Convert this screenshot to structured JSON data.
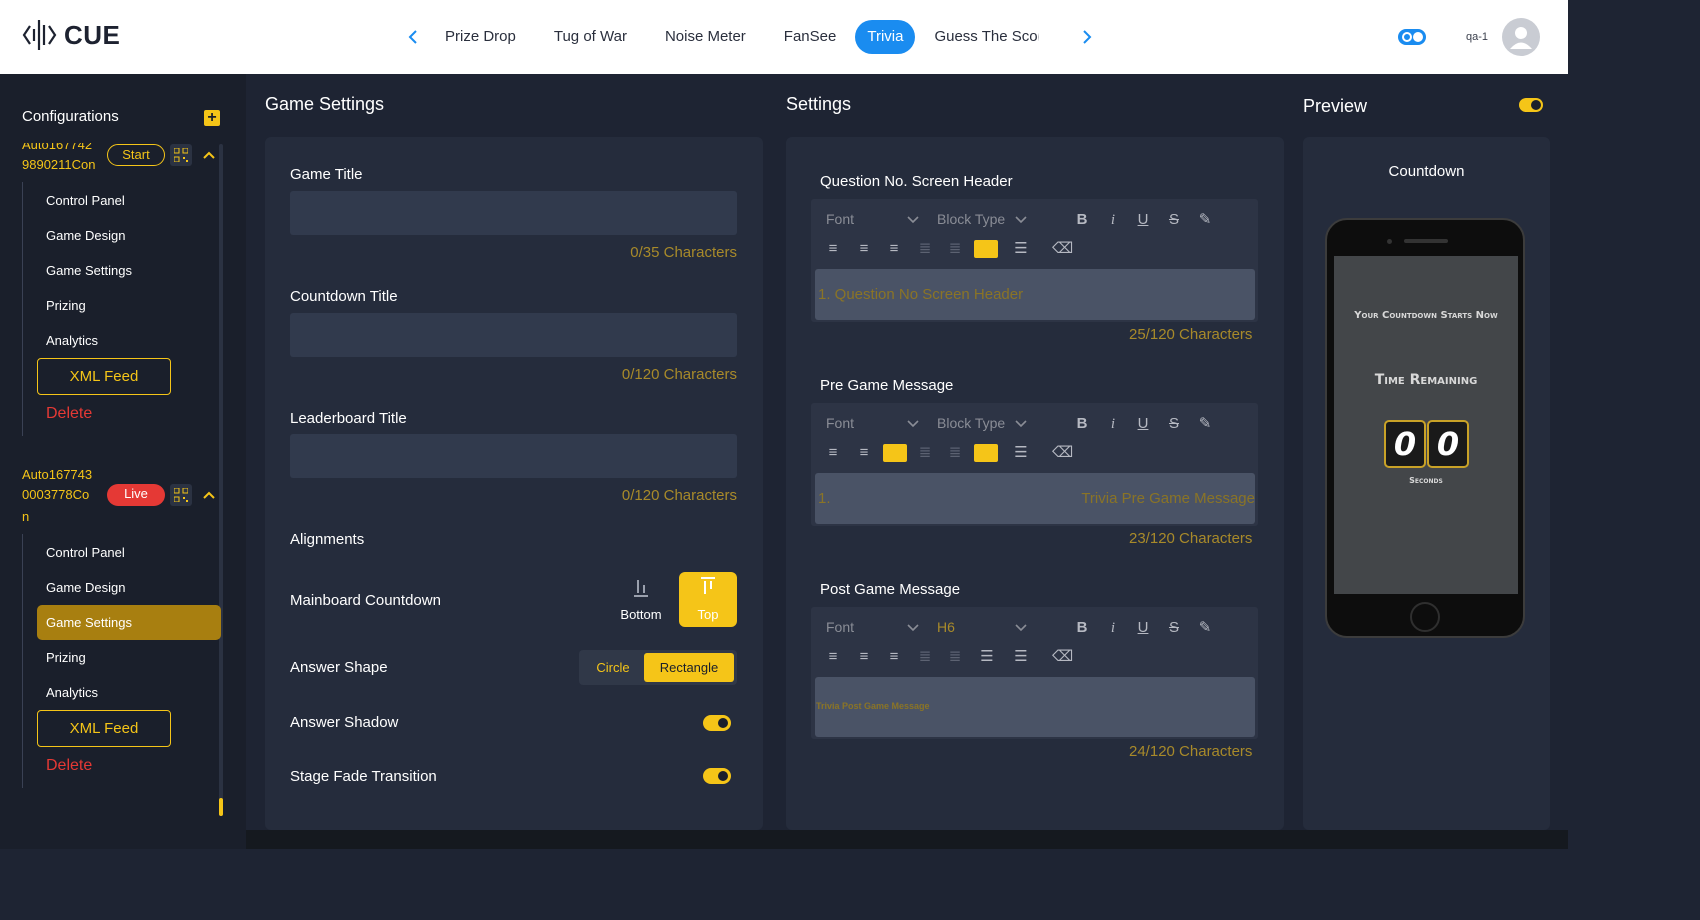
{
  "brand": {
    "name": "CUE"
  },
  "nav": {
    "tabs": [
      "Prize Drop",
      "Tug of War",
      "Noise Meter",
      "FanSee",
      "Trivia",
      "Guess The Score"
    ],
    "active_index": 4
  },
  "user": {
    "name": "qa-1"
  },
  "sidebar": {
    "heading": "Configurations",
    "configs": [
      {
        "name_line1": "Auto167742",
        "name_line2": "9890211Con",
        "status": "Start",
        "items": [
          "Control Panel",
          "Game Design",
          "Game Settings",
          "Prizing",
          "Analytics"
        ],
        "xml": "XML Feed",
        "delete": "Delete"
      },
      {
        "name_line1": "Auto167743",
        "name_line2": "0003778Co",
        "name_line3": "n",
        "status": "Live",
        "items": [
          "Control Panel",
          "Game Design",
          "Game Settings",
          "Prizing",
          "Analytics"
        ],
        "active_item": "Game Settings",
        "xml": "XML Feed",
        "delete": "Delete"
      }
    ]
  },
  "game_settings": {
    "heading": "Game Settings",
    "fields": [
      {
        "label": "Game Title",
        "value": "",
        "count": "0/35 Characters"
      },
      {
        "label": "Countdown Title",
        "value": "",
        "count": "0/120 Characters"
      },
      {
        "label": "Leaderboard Title",
        "value": "",
        "count": "0/120 Characters"
      }
    ],
    "alignments_label": "Alignments",
    "mainboard_label": "Mainboard Countdown",
    "bottom_label": "Bottom",
    "top_label": "Top",
    "answer_shape_label": "Answer Shape",
    "shape_circle": "Circle",
    "shape_rect": "Rectangle",
    "answer_shadow_label": "Answer Shadow",
    "answer_shadow_on": true,
    "stage_fade_label": "Stage Fade Transition",
    "stage_fade_on": true
  },
  "settings": {
    "heading": "Settings",
    "font_placeholder": "Font",
    "block_placeholder": "Block Type",
    "sections": [
      {
        "label": "Question No. Screen Header",
        "block": "Block Type",
        "content": "1.  Question No Screen Header",
        "count": "25/120 Characters"
      },
      {
        "label": "Pre Game Message",
        "block": "Block Type",
        "content_prefix": "1.",
        "content": "Trivia Pre Game Message",
        "count": "23/120 Characters"
      },
      {
        "label": "Post Game Message",
        "block": "H6",
        "content": "Trivia Post Game Message",
        "count": "24/120 Characters"
      }
    ]
  },
  "preview": {
    "heading": "Preview",
    "screen_label": "Countdown",
    "countdown_title": "Your Countdown Starts Now",
    "time_remaining": "Time Remaining",
    "digit1": "0",
    "digit2": "0",
    "seconds": "Seconds"
  },
  "colors": {
    "accent": "#f5c518",
    "primary_blue": "#1a8cf0",
    "live_red": "#e53935",
    "panel_bg": "#252c3c"
  }
}
